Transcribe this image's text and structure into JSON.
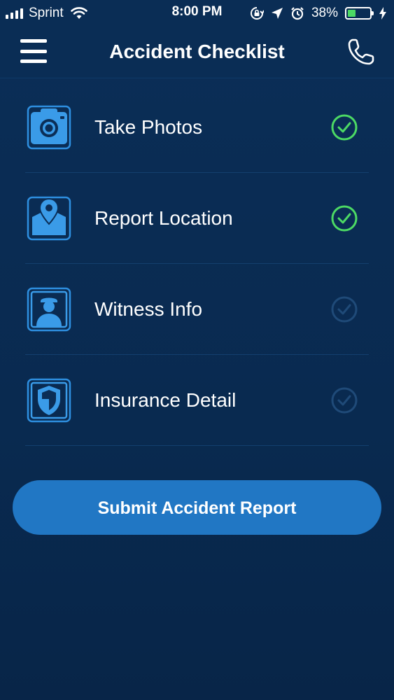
{
  "status_bar": {
    "carrier": "Sprint",
    "time": "8:00 PM",
    "battery_percent_text": "38%",
    "battery_level": 0.38,
    "icons": [
      "signal-bars-icon",
      "wifi-icon",
      "orientation-lock-icon",
      "location-arrow-icon",
      "alarm-icon",
      "battery-icon",
      "charging-bolt-icon"
    ]
  },
  "nav": {
    "title": "Accident Checklist",
    "left_icon": "menu-icon",
    "right_icon": "phone-icon"
  },
  "checklist": {
    "items": [
      {
        "label": "Take Photos",
        "icon": "camera-icon",
        "completed": true
      },
      {
        "label": "Report Location",
        "icon": "map-pin-icon",
        "completed": true
      },
      {
        "label": "Witness Info",
        "icon": "person-badge-icon",
        "completed": false
      },
      {
        "label": "Insurance Detail",
        "icon": "shield-icon",
        "completed": false
      }
    ]
  },
  "submit": {
    "label": "Submit Accident Report"
  },
  "colors": {
    "background": "#0a2a4f",
    "accent_blue": "#2177c4",
    "icon_blue": "#3a9be8",
    "check_done": "#4cd964",
    "check_pending": "#1f4a78"
  }
}
